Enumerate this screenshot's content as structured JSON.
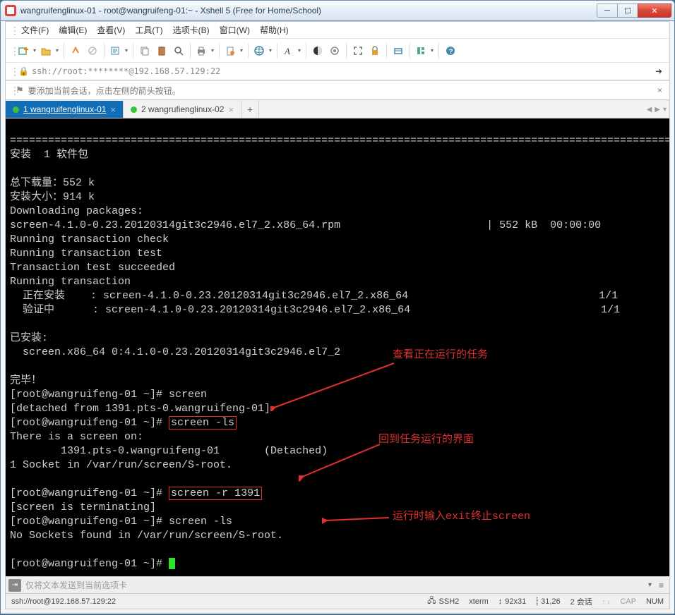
{
  "title": "wangruifenglinux-01 - root@wangruifeng-01:~ - Xshell 5 (Free for Home/School)",
  "menu": {
    "file": "文件(F)",
    "edit": "编辑(E)",
    "view": "查看(V)",
    "tools": "工具(T)",
    "tabs": "选项卡(B)",
    "window": "窗口(W)",
    "help": "帮助(H)"
  },
  "address": "ssh://root:********@192.168.57.129:22",
  "tip": "要添加当前会话，点击左侧的箭头按钮。",
  "tabs": {
    "t1": {
      "label": "1 wangruifenglinux-01"
    },
    "t2": {
      "label": "2 wangrufienglinux-02"
    }
  },
  "term": {
    "divider": "================================================================================================================",
    "l1": "安装  1 软件包",
    "l2": "",
    "l3": "总下载量：552 k",
    "l4": "安装大小：914 k",
    "l5": "Downloading packages:",
    "l6": "screen-4.1.0-0.23.20120314git3c2946.el7_2.x86_64.rpm                       | 552 kB  00:00:00",
    "l7": "Running transaction check",
    "l8": "Running transaction test",
    "l9": "Transaction test succeeded",
    "l10": "Running transaction",
    "l11": "  正在安装    : screen-4.1.0-0.23.20120314git3c2946.el7_2.x86_64                              1/1",
    "l12": "  验证中      : screen-4.1.0-0.23.20120314git3c2946.el7_2.x86_64                              1/1",
    "l13": "",
    "l14": "已安装:",
    "l15": "  screen.x86_64 0:4.1.0-0.23.20120314git3c2946.el7_2",
    "l16": "",
    "l17": "完毕！",
    "l18": "[root@wangruifeng-01 ~]# screen",
    "l19": "[detached from 1391.pts-0.wangruifeng-01]",
    "l20a": "[root@wangruifeng-01 ~]# ",
    "l20b": "screen -ls",
    "l21": "There is a screen on:",
    "l22": "        1391.pts-0.wangruifeng-01       (Detached)",
    "l23": "1 Socket in /var/run/screen/S-root.",
    "l24": "",
    "l25a": "[root@wangruifeng-01 ~]# ",
    "l25b": "screen -r 1391",
    "l26": "[screen is terminating]",
    "l27": "[root@wangruifeng-01 ~]# screen -ls",
    "l28": "No Sockets found in /var/run/screen/S-root.",
    "l29": "",
    "l30": "[root@wangruifeng-01 ~]# "
  },
  "annotations": {
    "n1": "查看正在运行的任务",
    "n2": "回到任务运行的界面",
    "n3": "运行时输入exit终止screen"
  },
  "sendbar": {
    "placeholder": "仅将文本发送到当前选项卡"
  },
  "status": {
    "conn": "ssh://root@192.168.57.129:22",
    "ssh": "SSH2",
    "term": "xterm",
    "size": "92x31",
    "cursor": "31,26",
    "sess": "2 会话",
    "cap": "CAP",
    "num": "NUM"
  }
}
